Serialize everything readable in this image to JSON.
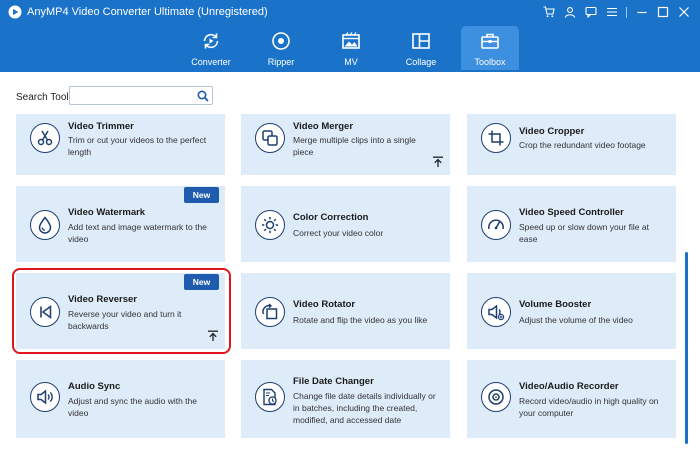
{
  "app": {
    "title": "AnyMP4 Video Converter Ultimate (Unregistered)"
  },
  "nav": {
    "tabs": [
      {
        "label": "Converter",
        "icon": "converter-icon"
      },
      {
        "label": "Ripper",
        "icon": "ripper-icon"
      },
      {
        "label": "MV",
        "icon": "mv-icon"
      },
      {
        "label": "Collage",
        "icon": "collage-icon"
      },
      {
        "label": "Toolbox",
        "icon": "toolbox-icon",
        "active": true
      }
    ]
  },
  "search": {
    "label": "Search Tool:",
    "value": "",
    "placeholder": ""
  },
  "tools": [
    {
      "name": "Video Trimmer",
      "desc": "Trim or cut your videos to the perfect length",
      "icon": "scissors-icon"
    },
    {
      "name": "Video Merger",
      "desc": "Merge multiple clips into a single piece",
      "icon": "merge-icon"
    },
    {
      "name": "Video Cropper",
      "desc": "Crop the redundant video footage",
      "icon": "crop-icon"
    },
    {
      "name": "Video Watermark",
      "desc": "Add text and image watermark to the video",
      "icon": "drop-icon",
      "badge": "New"
    },
    {
      "name": "Color Correction",
      "desc": "Correct your video color",
      "icon": "sun-icon"
    },
    {
      "name": "Video Speed Controller",
      "desc": "Speed up or slow down your file at ease",
      "icon": "speedometer-icon"
    },
    {
      "name": "Video Reverser",
      "desc": "Reverse your video and turn it backwards",
      "icon": "rewind-icon",
      "badge": "New"
    },
    {
      "name": "Video Rotator",
      "desc": "Rotate and flip the video as you like",
      "icon": "rotate-icon"
    },
    {
      "name": "Volume Booster",
      "desc": "Adjust the volume of the video",
      "icon": "speaker-icon"
    },
    {
      "name": "Audio Sync",
      "desc": "Adjust and sync the audio with the video",
      "icon": "audio-sync-icon"
    },
    {
      "name": "File Date Changer",
      "desc": "Change file date details individually or in batches, including the created, modified, and accessed date",
      "icon": "file-clock-icon"
    },
    {
      "name": "Video/Audio Recorder",
      "desc": "Record video/audio in high quality on your computer",
      "icon": "record-icon"
    }
  ],
  "colors": {
    "header": "#1a73c9",
    "active_tab": "#3d8fe0",
    "card": "#deebf9",
    "badge": "#1f5baf",
    "highlight": "#e0161e"
  }
}
